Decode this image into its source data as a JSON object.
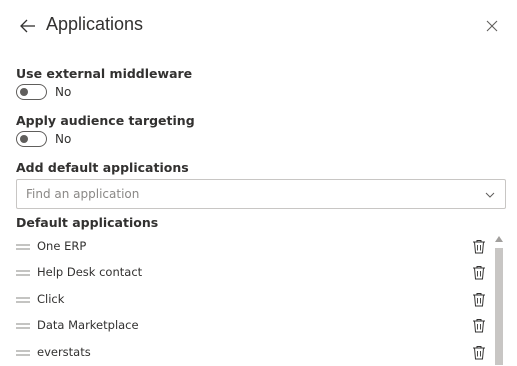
{
  "panel": {
    "title": "Applications"
  },
  "settings": {
    "middleware": {
      "label": "Use external middleware",
      "state_text": "No",
      "enabled": false
    },
    "audience": {
      "label": "Apply audience targeting",
      "state_text": "No",
      "enabled": false
    }
  },
  "add_apps": {
    "label": "Add default applications",
    "placeholder": "Find an application"
  },
  "defaults": {
    "label": "Default applications",
    "items": [
      {
        "label": "One ERP"
      },
      {
        "label": "Help Desk contact"
      },
      {
        "label": "Click"
      },
      {
        "label": "Data Marketplace"
      },
      {
        "label": "everstats"
      }
    ]
  },
  "colors": {
    "text": "#323130",
    "border": "#c8c6c4",
    "placeholder": "#8a8886",
    "toggle_off": "#605e5c"
  },
  "icons": {
    "back": "arrow-left-icon",
    "close": "close-icon",
    "dropdown": "chevron-down-icon",
    "grip": "drag-handle-icon",
    "delete": "trash-icon"
  }
}
